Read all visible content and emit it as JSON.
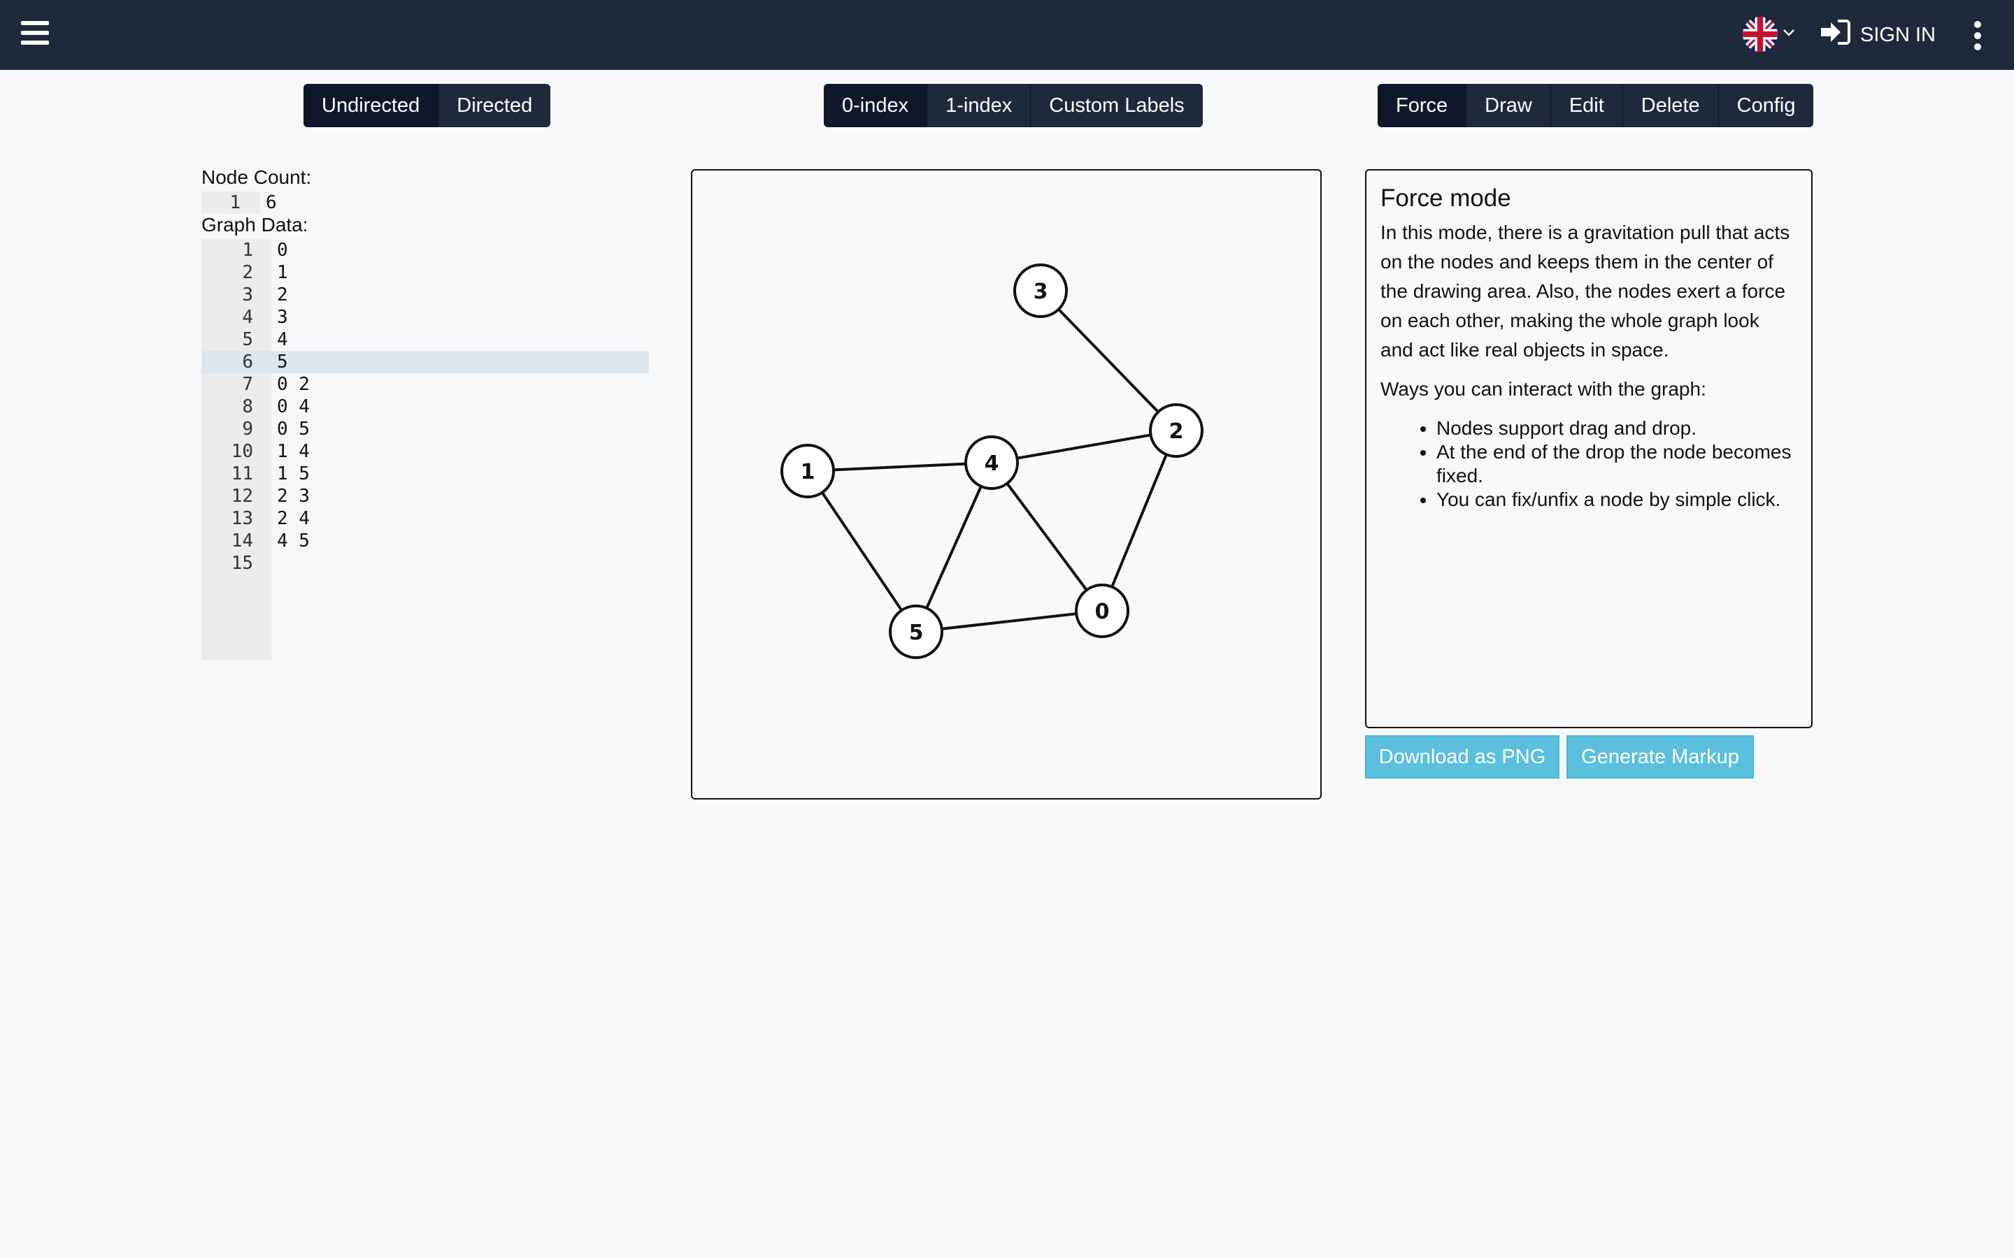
{
  "topbar": {
    "signin_label": "SIGN IN",
    "flag_icon": "uk-flag-icon",
    "menu_icon": "hamburger-menu-icon",
    "more_icon": "vertical-dots-icon"
  },
  "direction_group": [
    {
      "label": "Undirected",
      "active": true
    },
    {
      "label": "Directed",
      "active": false
    }
  ],
  "index_group": [
    {
      "label": "0-index",
      "active": true
    },
    {
      "label": "1-index",
      "active": false
    },
    {
      "label": "Custom Labels",
      "active": false
    }
  ],
  "mode_group": [
    {
      "label": "Force",
      "active": true
    },
    {
      "label": "Draw",
      "active": false
    },
    {
      "label": "Edit",
      "active": false
    },
    {
      "label": "Delete",
      "active": false
    },
    {
      "label": "Config",
      "active": false
    }
  ],
  "node_count": {
    "label": "Node Count:",
    "lines": [
      {
        "num": "1",
        "text": "6"
      }
    ]
  },
  "graph_data": {
    "label": "Graph Data:",
    "active_line": 6,
    "lines": [
      {
        "num": "1",
        "text": "0"
      },
      {
        "num": "2",
        "text": "1"
      },
      {
        "num": "3",
        "text": "2"
      },
      {
        "num": "4",
        "text": "3"
      },
      {
        "num": "5",
        "text": "4"
      },
      {
        "num": "6",
        "text": "5"
      },
      {
        "num": "7",
        "text": "0 2"
      },
      {
        "num": "8",
        "text": "0 4"
      },
      {
        "num": "9",
        "text": "0 5"
      },
      {
        "num": "10",
        "text": "1 4"
      },
      {
        "num": "11",
        "text": "1 5"
      },
      {
        "num": "12",
        "text": "2 3"
      },
      {
        "num": "13",
        "text": "2 4"
      },
      {
        "num": "14",
        "text": "4 5"
      },
      {
        "num": "15",
        "text": ""
      }
    ]
  },
  "graph": {
    "nodes": [
      "0",
      "1",
      "2",
      "3",
      "4",
      "5"
    ],
    "edges": [
      [
        "0",
        "2"
      ],
      [
        "0",
        "4"
      ],
      [
        "0",
        "5"
      ],
      [
        "1",
        "4"
      ],
      [
        "1",
        "5"
      ],
      [
        "2",
        "3"
      ],
      [
        "2",
        "4"
      ],
      [
        "4",
        "5"
      ]
    ]
  },
  "info": {
    "title": "Force mode",
    "paragraph1": "In this mode, there is a gravitation pull that acts on the nodes and keeps them in the center of the drawing area. Also, the nodes exert a force on each other, making the whole graph look and act like real objects in space.",
    "paragraph2": "Ways you can interact with the graph:",
    "bullets": [
      "Nodes support drag and drop.",
      "At the end of the drop the node becomes fixed.",
      "You can fix/unfix a node by simple click."
    ]
  },
  "actions": {
    "download_label": "Download as PNG",
    "markup_label": "Generate Markup"
  }
}
